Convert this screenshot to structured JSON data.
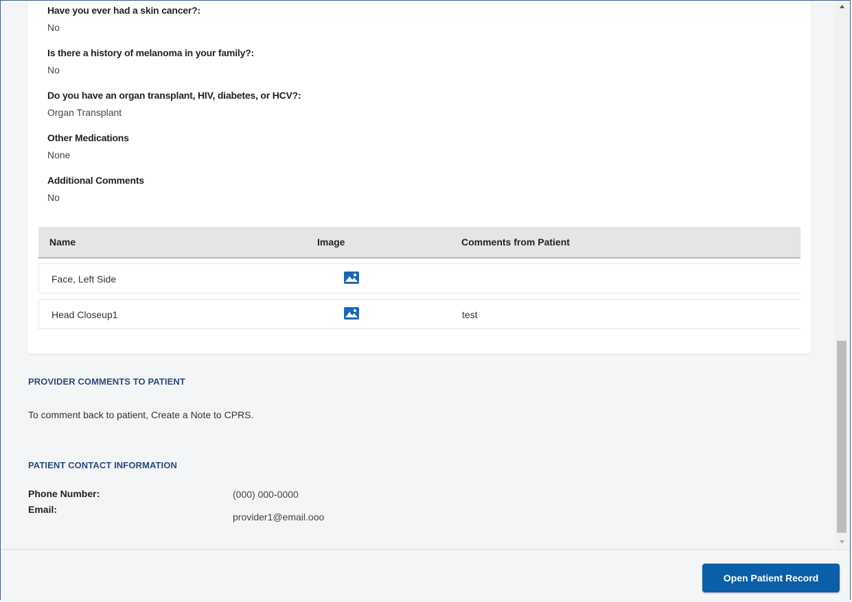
{
  "questions": [
    {
      "q": "Have you ever had a skin cancer?:",
      "a": "No"
    },
    {
      "q": "Is there a history of melanoma in your family?:",
      "a": "No"
    },
    {
      "q": "Do you have an organ transplant, HIV, diabetes, or HCV?:",
      "a": "Organ Transplant"
    },
    {
      "q": "Other Medications",
      "a": "None"
    },
    {
      "q": "Additional Comments",
      "a": "No"
    }
  ],
  "table": {
    "headers": [
      "Name",
      "Image",
      "Comments from Patient"
    ],
    "rows": [
      {
        "name": "Face, Left Side",
        "image": "image-icon",
        "comment": ""
      },
      {
        "name": "Head Closeup1",
        "image": "image-icon",
        "comment": "test"
      }
    ]
  },
  "provider_comments": {
    "title": "PROVIDER COMMENTS TO PATIENT",
    "text": "To comment back to patient, Create a Note to CPRS."
  },
  "contact": {
    "title": "PATIENT CONTACT INFORMATION",
    "phone_label": "Phone Number:",
    "phone_value": "(000) 000-0000",
    "email_label": "Email:",
    "email_value": "provider1@email.ooo"
  },
  "footer": {
    "button_label": "Open Patient Record"
  },
  "colors": {
    "accent": "#0b5ea8",
    "section_title": "#2b4a7c",
    "icon": "#1a67b3"
  }
}
